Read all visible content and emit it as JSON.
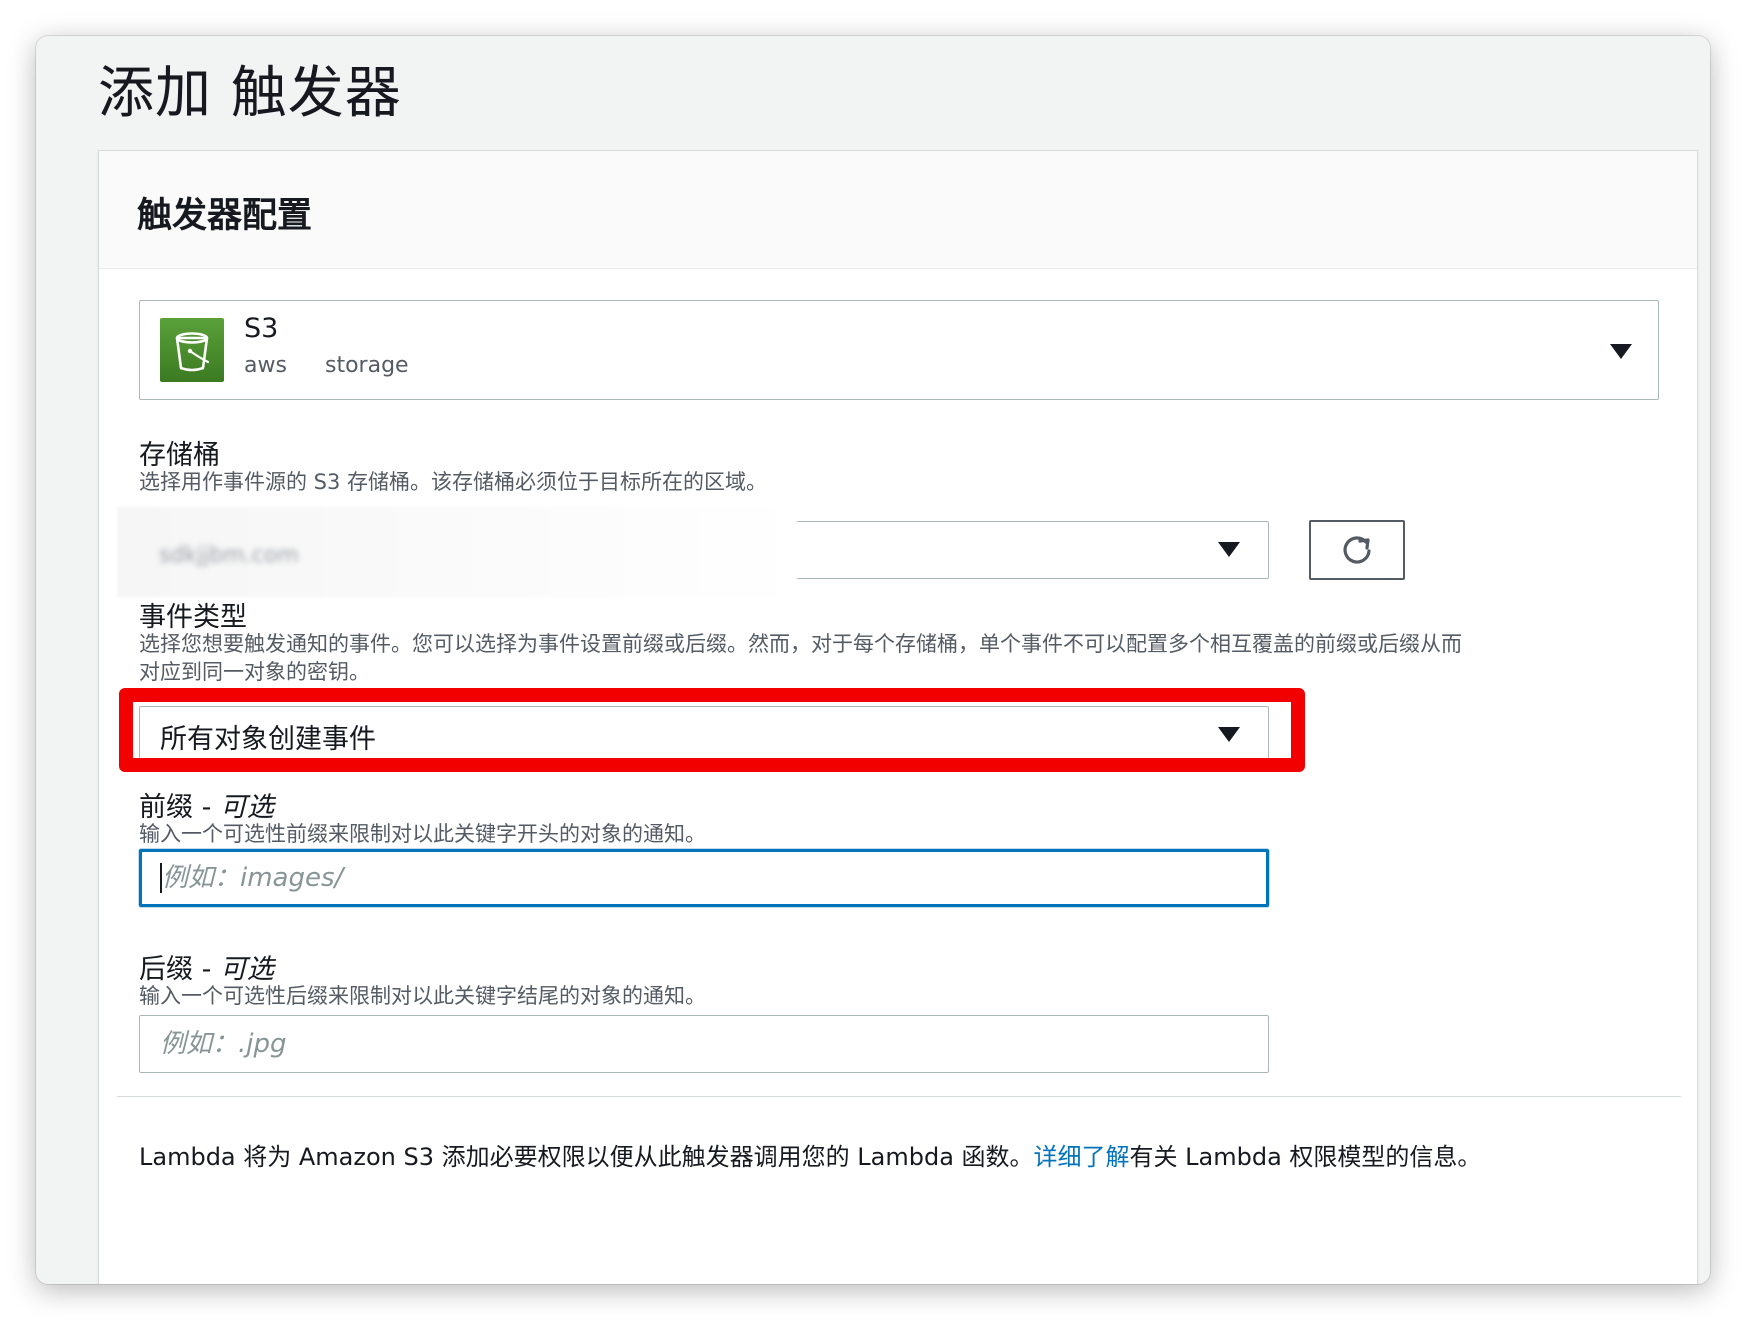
{
  "page": {
    "title": "添加 触发器"
  },
  "panel": {
    "title": "触发器配置"
  },
  "service": {
    "name": "S3",
    "tags": [
      "aws",
      "storage"
    ],
    "icon": "s3-bucket-icon",
    "icon_color": "#3b7a21"
  },
  "bucket": {
    "label": "存储桶",
    "description": "选择用作事件源的 S3 存储桶。该存储桶必须位于目标所在的区域。",
    "value": "sdkjjbm.com",
    "refresh_icon": "refresh-icon"
  },
  "event_type": {
    "label": "事件类型",
    "description_line1": "选择您想要触发通知的事件。您可以选择为事件设置前缀或后缀。然而，对于每个存储桶，单个事件不可以配置多个相互覆盖的前缀或后缀从而",
    "description_line2": "对应到同一对象的密钥。",
    "selected": "所有对象创建事件"
  },
  "prefix": {
    "label": "前缀 - ",
    "optional": "可选",
    "description": "输入一个可选性前缀来限制对以此关键字开头的对象的通知。",
    "placeholder": "例如：images/",
    "value": ""
  },
  "suffix": {
    "label": "后缀 - ",
    "optional": "可选",
    "description": "输入一个可选性后缀来限制对以此关键字结尾的对象的通知。",
    "placeholder": "例如：.jpg",
    "value": ""
  },
  "footer": {
    "text_before": "Lambda 将为 Amazon S3 添加必要权限以便从此触发器调用您的 Lambda 函数。",
    "link": "详细了解",
    "text_after": "有关 Lambda 权限模型的信息。"
  },
  "colors": {
    "accent": "#0073bb",
    "highlight": "#f20000",
    "text": "#16191f",
    "muted": "#545b64"
  }
}
